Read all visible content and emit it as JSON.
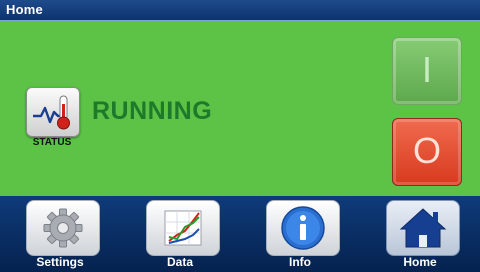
{
  "titlebar": {
    "title": "Home"
  },
  "status": {
    "icon": "thermometer-pulse-icon",
    "label": "STATUS",
    "state": "RUNNING",
    "state_color": "#1d7a2a",
    "background": "#5cc347"
  },
  "controls": {
    "on_label": "I",
    "off_label": "O",
    "on_color": "#6dbf5c",
    "off_color": "#e0482b"
  },
  "nav": {
    "tabs": [
      {
        "label": "Settings",
        "icon": "gear-icon"
      },
      {
        "label": "Data",
        "icon": "chart-icon"
      },
      {
        "label": "Info",
        "icon": "info-icon"
      },
      {
        "label": "Home",
        "icon": "home-icon",
        "active": true
      }
    ]
  }
}
